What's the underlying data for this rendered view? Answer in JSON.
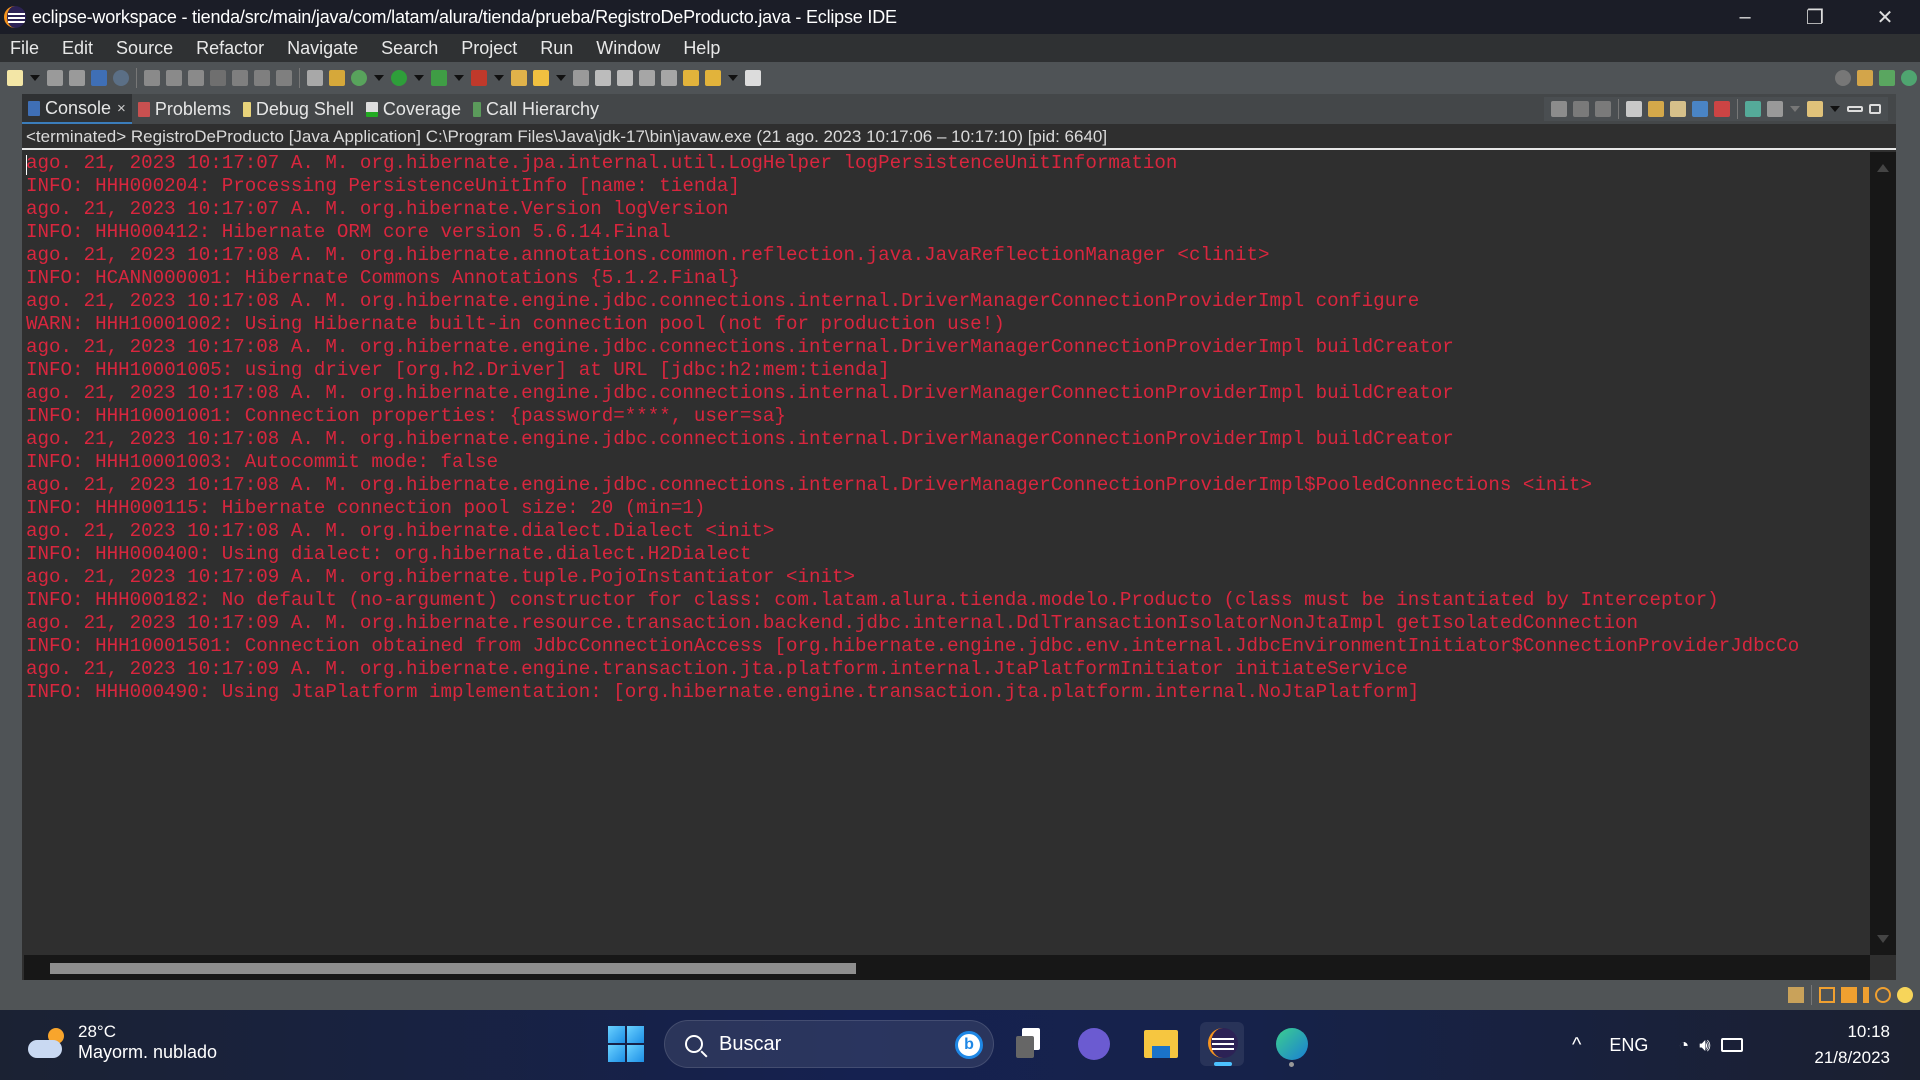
{
  "window": {
    "title": "eclipse-workspace - tienda/src/main/java/com/latam/alura/tienda/prueba/RegistroDeProducto.java - Eclipse IDE",
    "controls": {
      "minimize": "–",
      "restore": "❐",
      "close": "✕"
    }
  },
  "menu": [
    "File",
    "Edit",
    "Source",
    "Refactor",
    "Navigate",
    "Search",
    "Project",
    "Run",
    "Window",
    "Help"
  ],
  "toolbar_icons": [
    "new-icon",
    "save-icon",
    "save-all-icon",
    "console-icon",
    "skip-breakpoints-icon",
    "resume-icon",
    "suspend-icon",
    "terminate-icon",
    "disconnect-icon",
    "step-into-icon",
    "step-over-icon",
    "step-return-icon",
    "drop-to-frame-icon",
    "use-step-filters-icon",
    "debug-icon",
    "run-icon",
    "coverage-icon",
    "run-external-icon",
    "open-type-icon",
    "open-task-icon",
    "toggle-mark-occurrences-icon",
    "toggle-word-wrap-icon",
    "show-whitespace-icon",
    "next-annotation-icon",
    "prev-annotation-icon",
    "back-icon",
    "forward-icon",
    "pin-editor-icon"
  ],
  "tabs": [
    {
      "label": "Console",
      "icon": "console-icon",
      "active": true,
      "closable": true
    },
    {
      "label": "Problems",
      "icon": "problems-icon"
    },
    {
      "label": "Debug Shell",
      "icon": "debug-shell-icon"
    },
    {
      "label": "Coverage",
      "icon": "coverage-icon"
    },
    {
      "label": "Call Hierarchy",
      "icon": "call-hierarchy-icon"
    }
  ],
  "console": {
    "status": "<terminated> RegistroDeProducto [Java Application] C:\\Program Files\\Java\\jdk-17\\bin\\javaw.exe  (21 ago. 2023 10:17:06 – 10:17:10) [pid: 6640]",
    "text_color": "#d9263e",
    "lines": [
      "ago. 21, 2023 10:17:07 A. M. org.hibernate.jpa.internal.util.LogHelper logPersistenceUnitInformation",
      "INFO: HHH000204: Processing PersistenceUnitInfo [name: tienda]",
      "ago. 21, 2023 10:17:07 A. M. org.hibernate.Version logVersion",
      "INFO: HHH000412: Hibernate ORM core version 5.6.14.Final",
      "ago. 21, 2023 10:17:08 A. M. org.hibernate.annotations.common.reflection.java.JavaReflectionManager <clinit>",
      "INFO: HCANN000001: Hibernate Commons Annotations {5.1.2.Final}",
      "ago. 21, 2023 10:17:08 A. M. org.hibernate.engine.jdbc.connections.internal.DriverManagerConnectionProviderImpl configure",
      "WARN: HHH10001002: Using Hibernate built-in connection pool (not for production use!)",
      "ago. 21, 2023 10:17:08 A. M. org.hibernate.engine.jdbc.connections.internal.DriverManagerConnectionProviderImpl buildCreator",
      "INFO: HHH10001005: using driver [org.h2.Driver] at URL [jdbc:h2:mem:tienda]",
      "ago. 21, 2023 10:17:08 A. M. org.hibernate.engine.jdbc.connections.internal.DriverManagerConnectionProviderImpl buildCreator",
      "INFO: HHH10001001: Connection properties: {password=****, user=sa}",
      "ago. 21, 2023 10:17:08 A. M. org.hibernate.engine.jdbc.connections.internal.DriverManagerConnectionProviderImpl buildCreator",
      "INFO: HHH10001003: Autocommit mode: false",
      "ago. 21, 2023 10:17:08 A. M. org.hibernate.engine.jdbc.connections.internal.DriverManagerConnectionProviderImpl$PooledConnections <init>",
      "INFO: HHH000115: Hibernate connection pool size: 20 (min=1)",
      "ago. 21, 2023 10:17:08 A. M. org.hibernate.dialect.Dialect <init>",
      "INFO: HHH000400: Using dialect: org.hibernate.dialect.H2Dialect",
      "ago. 21, 2023 10:17:09 A. M. org.hibernate.tuple.PojoInstantiator <init>",
      "INFO: HHH000182: No default (no-argument) constructor for class: com.latam.alura.tienda.modelo.Producto (class must be instantiated by Interceptor)",
      "ago. 21, 2023 10:17:09 A. M. org.hibernate.resource.transaction.backend.jdbc.internal.DdlTransactionIsolatorNonJtaImpl getIsolatedConnection",
      "INFO: HHH10001501: Connection obtained from JdbcConnectionAccess [org.hibernate.engine.jdbc.env.internal.JdbcEnvironmentInitiator$ConnectionProviderJdbcCo",
      "ago. 21, 2023 10:17:09 A. M. org.hibernate.engine.transaction.jta.platform.internal.JtaPlatformInitiator initiateService",
      "INFO: HHH000490: Using JtaPlatform implementation: [org.hibernate.engine.transaction.jta.platform.internal.NoJtaPlatform]"
    ]
  },
  "taskbar": {
    "weather": {
      "temp": "28°C",
      "desc": "Mayorm. nublado"
    },
    "search_placeholder": "Buscar",
    "apps": [
      "task-view-icon",
      "teams-chat-icon",
      "file-explorer-icon",
      "eclipse-icon",
      "edge-icon"
    ],
    "tray": {
      "chevron": "^",
      "lang": "ENG"
    },
    "clock": {
      "time": "10:18",
      "date": "21/8/2023"
    }
  }
}
